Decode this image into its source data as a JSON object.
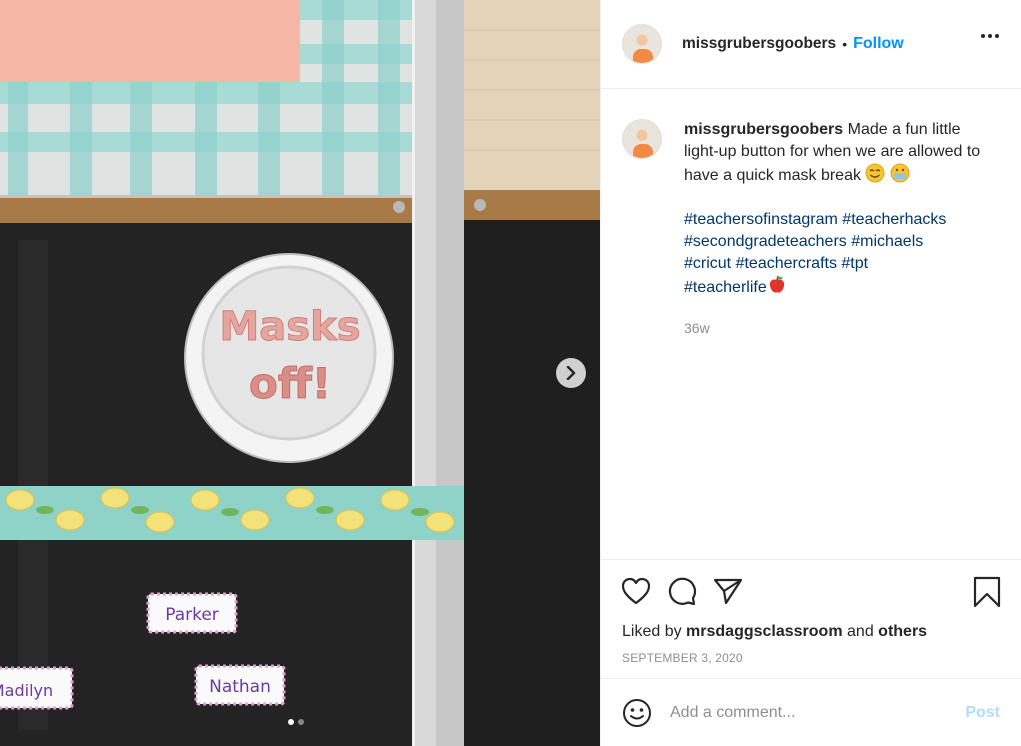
{
  "post": {
    "username": "missgrubersgoobers",
    "follow_label": "Follow",
    "separator": "•",
    "caption_text": "Made a fun little light-up button for when we are allowed to have a quick mask break",
    "hashtags_line1": "#teachersofinstagram #teacherhacks",
    "hashtags_line2": "#secondgradeteachers #michaels",
    "hashtags_line3": "#cricut #teachercrafts #tpt",
    "hashtags_line4": "#teacherlife",
    "age": "36w",
    "liked_prefix": "Liked by",
    "liked_user": "mrsdaggsclassroom",
    "liked_and": "and",
    "liked_others": "others",
    "date": "SEPTEMBER 3, 2020"
  },
  "comment": {
    "placeholder": "Add a comment...",
    "post_label": "Post"
  },
  "photo": {
    "button_text_line1": "Masks",
    "button_text_line2": "off!",
    "name_tag_1": "Parker",
    "name_tag_2": "Nathan",
    "name_tag_3": "Madilyn",
    "slide_count": 2,
    "active_slide": 1
  },
  "icons": {
    "like": "heart-icon",
    "comment": "comment-icon",
    "share": "share-icon",
    "save": "bookmark-icon",
    "more": "more-icon",
    "emoji": "smiley-icon",
    "next": "chevron-right-icon"
  },
  "colors": {
    "link_blue": "#0095f6",
    "hashtag_blue": "#00376b",
    "muted": "#8e8e8e",
    "post_disabled": "#b3dbff"
  }
}
